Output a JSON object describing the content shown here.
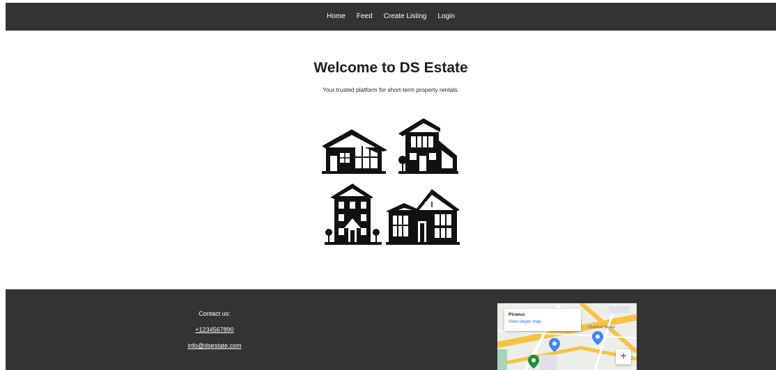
{
  "nav": {
    "items": [
      {
        "label": "Home"
      },
      {
        "label": "Feed"
      },
      {
        "label": "Create Listing"
      },
      {
        "label": "Login"
      }
    ]
  },
  "hero": {
    "title": "Welcome to DS Estate",
    "subtitle": "Your trusted platform for short-term property rentals."
  },
  "footer": {
    "contact_label": "Contact us:",
    "phone": "+1234567890",
    "email": "info@dsestate.com",
    "map": {
      "place": "Piraeus",
      "view_larger": "View larger map",
      "zoom_in": "+",
      "street_label": "ΠΛΑΤΕΙΑ Πειραιά"
    }
  },
  "colors": {
    "nav_bg": "#333333",
    "footer_bg": "#333333",
    "text_dark": "#1d1d1d",
    "link": "#1a73e8"
  },
  "icons": [
    "houses-illustration-icon",
    "map-pin-icon"
  ]
}
